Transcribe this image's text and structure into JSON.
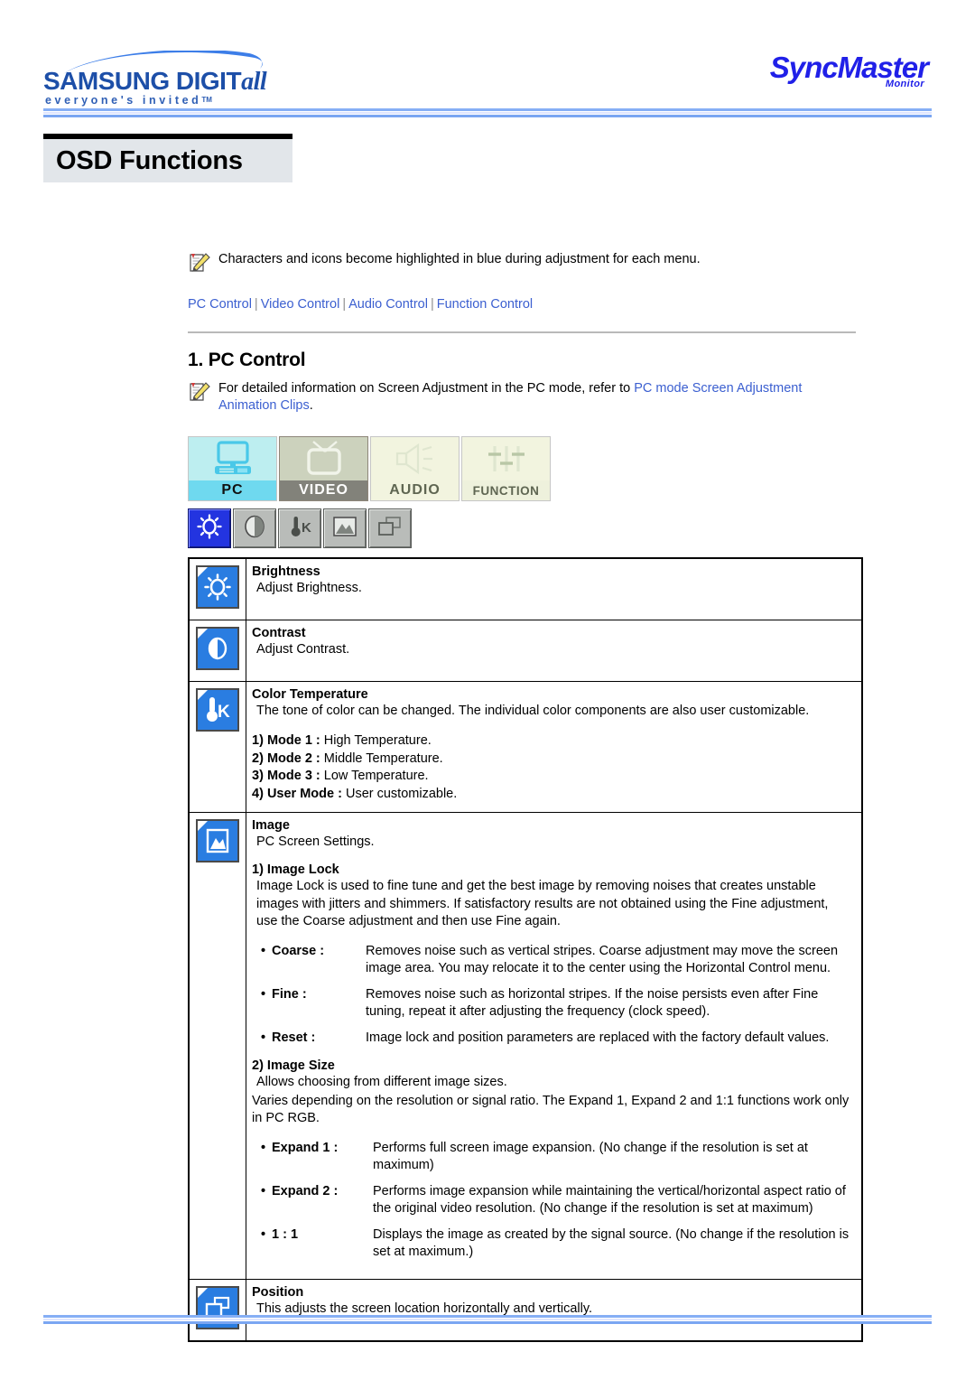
{
  "header": {
    "brand_logo": "samsung-digitall-logo",
    "brand_word_samsung": "SAMSUNG DIGIT",
    "brand_word_digitall": "all",
    "brand_tagline": "everyone's invited",
    "brand_tagline_tm": "TM",
    "product_logo": "SyncMaster",
    "product_sub": "Monitor"
  },
  "page_title": "OSD Functions",
  "note": {
    "icon": "note-pencil-icon",
    "text": "Characters and icons become highlighted in blue during adjustment for each menu."
  },
  "breadcrumb": {
    "items": [
      "PC Control",
      "Video Control",
      "Audio Control",
      "Function Control"
    ],
    "separator": "|"
  },
  "section": {
    "number_title": "1. PC Control",
    "note_icon": "note-pencil-icon",
    "note_prefix": "For detailed information on Screen Adjustment in the PC mode, refer to ",
    "note_link": "PC mode Screen Adjustment Animation Clips",
    "note_suffix": "."
  },
  "tabs": [
    {
      "label": "PC",
      "icon": "monitor-icon",
      "state": "active"
    },
    {
      "label": "VIDEO",
      "icon": "television-icon",
      "state": "inactive"
    },
    {
      "label": "AUDIO",
      "icon": "speaker-icon",
      "state": "inactive"
    },
    {
      "label": "FUNCTION",
      "icon": "sliders-icon",
      "state": "inactive"
    }
  ],
  "toolbar": [
    {
      "icon": "brightness-sun-icon",
      "state": "selected"
    },
    {
      "icon": "contrast-circle-icon",
      "state": "normal"
    },
    {
      "icon": "color-temperature-icon",
      "state": "normal"
    },
    {
      "icon": "image-picture-icon",
      "state": "normal"
    },
    {
      "icon": "position-windows-icon",
      "state": "normal"
    }
  ],
  "colors": {
    "link": "#3b5fd0",
    "icon_blue": "#2a7de1",
    "toolbar_active": "#2334e0",
    "rule_blue": "#86aff5",
    "title_bg": "#e2e6ea",
    "tab_pc": "#6fd9ef",
    "tab_video": "#82827a"
  },
  "rows": [
    {
      "icon": "brightness-sun-icon",
      "title": "Brightness",
      "body": "Adjust Brightness."
    },
    {
      "icon": "contrast-circle-icon",
      "title": "Contrast",
      "body": "Adjust Contrast."
    },
    {
      "icon": "color-temperature-icon",
      "title": "Color Temperature",
      "body": "The tone of color can be changed. The individual color components are also user customizable.",
      "modes": [
        {
          "num": "1)",
          "name": "Mode 1 :",
          "desc": "High Temperature."
        },
        {
          "num": "2)",
          "name": "Mode 2 :",
          "desc": "Middle Temperature."
        },
        {
          "num": "3)",
          "name": "Mode 3 :",
          "desc": "Low Temperature."
        },
        {
          "num": "4)",
          "name": "User Mode :",
          "desc": "User customizable."
        }
      ]
    },
    {
      "icon": "image-picture-icon",
      "title": "Image",
      "body": "PC Screen Settings.",
      "sub1_head": "1) Image Lock",
      "sub1_body": "Image Lock is used to fine tune and get the best image by removing noises that creates unstable images with jitters and shimmers. If satisfactory results are not obtained using the Fine adjustment, use the Coarse adjustment and then use Fine again.",
      "sub1_bullets": [
        {
          "key": "Coarse :",
          "value": "Removes noise such as vertical stripes. Coarse adjustment may move the screen image area. You may relocate it to the center using the Horizontal Control menu."
        },
        {
          "key": "Fine :",
          "value": "Removes noise such as horizontal stripes. If the noise persists even after Fine tuning, repeat it after adjusting the frequency (clock speed)."
        },
        {
          "key": "Reset :",
          "value": "Image lock and position parameters are replaced with the factory default values."
        }
      ],
      "sub2_head": "2) Image Size",
      "sub2_body1": "Allows choosing from different image sizes.",
      "sub2_body2": "Varies depending on the resolution or signal ratio. The Expand 1, Expand 2 and 1:1 functions work only in PC RGB.",
      "sub2_bullets": [
        {
          "key": "Expand 1 :",
          "value": "Performs full screen image expansion. (No change if the resolution is set at maximum)"
        },
        {
          "key": "Expand 2 :",
          "value": "Performs image expansion while maintaining the vertical/horizontal aspect ratio of the original video resolution. (No change if the resolution is set at maximum)"
        },
        {
          "key": "1 : 1",
          "value": "Displays the image as created by the signal source. (No change if the resolution is set at maximum.)"
        }
      ]
    },
    {
      "icon": "position-windows-icon",
      "title": "Position",
      "body": "This adjusts the screen location horizontally and vertically."
    }
  ]
}
